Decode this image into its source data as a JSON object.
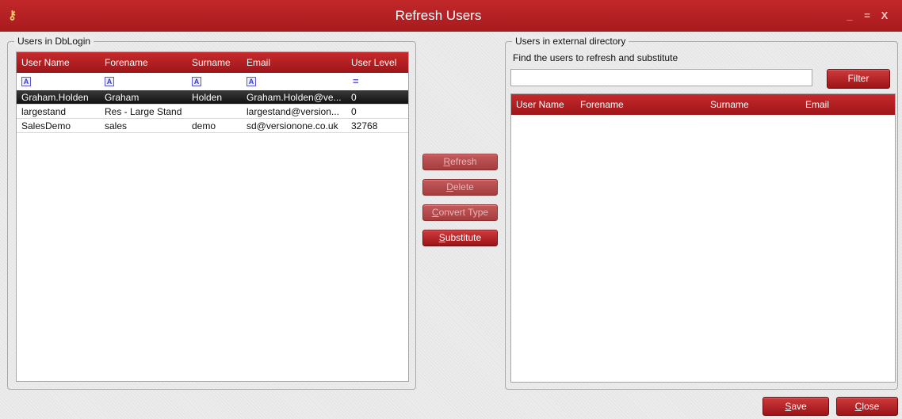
{
  "window": {
    "title": "Refresh Users",
    "minimize": "_",
    "maximize": "=",
    "close": "X"
  },
  "left_group": {
    "label": "Users in DbLogin",
    "columns": [
      "User Name",
      "Forename",
      "Surname",
      "Email",
      "User Level"
    ],
    "filter_glyph": "A",
    "filter_eq": "=",
    "rows": [
      {
        "user": "Graham.Holden",
        "forename": "Graham",
        "surname": "Holden",
        "email": "Graham.Holden@ve...",
        "level": "0",
        "selected": true
      },
      {
        "user": "largestand",
        "forename": "Res - Large Stand",
        "surname": "",
        "email": "largestand@version...",
        "level": "0",
        "selected": false
      },
      {
        "user": "SalesDemo",
        "forename": "sales",
        "surname": "demo",
        "email": "sd@versionone.co.uk",
        "level": "32768",
        "selected": false
      }
    ]
  },
  "actions": {
    "refresh_first": "R",
    "refresh_rest": "efresh",
    "delete_first": "D",
    "delete_rest": "elete",
    "convert_first": "C",
    "convert_rest": "onvert Type",
    "substitute_first": "S",
    "substitute_rest": "ubstitute"
  },
  "right_group": {
    "label": "Users in external directory",
    "instruction": "Find the users to refresh and substitute",
    "search_value": "",
    "filter_button": "Filter",
    "columns": [
      "User Name",
      "Forename",
      "Surname",
      "Email"
    ]
  },
  "footer": {
    "save_first": "S",
    "save_rest": "ave",
    "close_first": "C",
    "close_rest": "lose"
  },
  "colors": {
    "accent": "#b01f22",
    "selected_row": "#1a1a1a"
  }
}
